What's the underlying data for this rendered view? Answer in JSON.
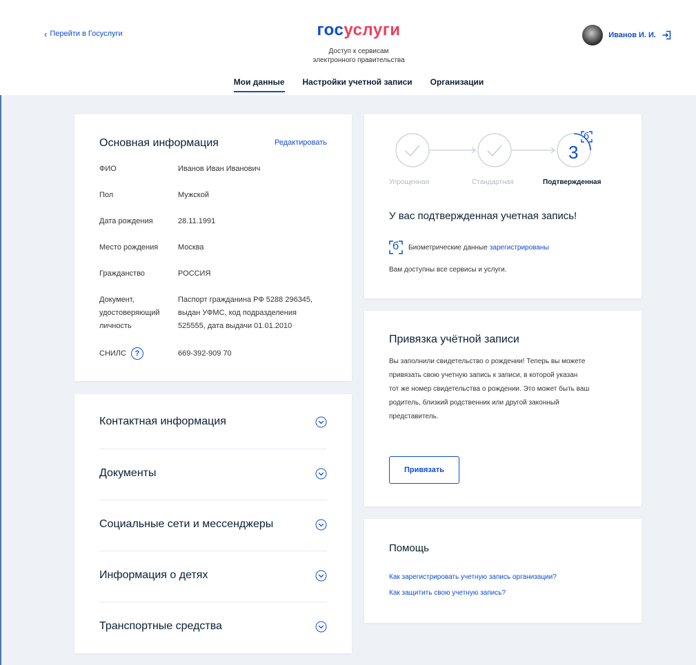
{
  "header": {
    "back_label": "Перейти в Госуслуги",
    "logo_part1": "гос",
    "logo_part2": "услуги",
    "subtitle_line1": "Доступ к сервисам",
    "subtitle_line2": "электронного правительства",
    "user_name": "Иванов И. И.",
    "tabs": [
      {
        "label": "Мои данные",
        "active": true
      },
      {
        "label": "Настройки учетной записи",
        "active": false
      },
      {
        "label": "Организации",
        "active": false
      }
    ]
  },
  "basic_info": {
    "title": "Основная информация",
    "edit_label": "Редактировать",
    "rows": [
      {
        "label": "ФИО",
        "value": "Иванов Иван Иванович"
      },
      {
        "label": "Пол",
        "value": "Мужской"
      },
      {
        "label": "Дата рождения",
        "value": "28.11.1991"
      },
      {
        "label": "Место рождения",
        "value": "Москва"
      },
      {
        "label": "Гражданство",
        "value": "РОССИЯ"
      },
      {
        "label_lines": [
          "Документ,",
          "удостоверяющий",
          "личность"
        ],
        "value_lines": [
          "Паспорт гражданина РФ 5288 296345,",
          "выдан УФМС, код подразделения",
          "525555, дата выдачи 01.01.2010"
        ]
      },
      {
        "label": "СНИЛС",
        "value": "669-392-909 70",
        "help": "?"
      }
    ]
  },
  "accordion": [
    "Контактная информация",
    "Документы",
    "Социальные сети и мессенджеры",
    "Информация о детях",
    "Транспортные средства"
  ],
  "status": {
    "steps": [
      "Упрощенная",
      "Стандартная",
      "Подтвержденная"
    ],
    "current_level": "3",
    "badge_letter": "б",
    "title": "У вас подтвержденная учетная запись!",
    "bio_text": "Биометрические данные",
    "bio_link": "зарегистрированы",
    "available": "Вам доступны все сервисы и услуги."
  },
  "binding": {
    "title": "Привязка учётной записи",
    "text_lines": [
      "Вы заполнили свидетельство о рождении! Теперь вы можете",
      "привязать свою учетную запись к записи, в которой указан",
      "тот же номер свидетельства о рождении. Это может быть ваш",
      "родитель, близкий родственник или другой законный",
      "представитель."
    ],
    "button_label": "Привязать"
  },
  "help": {
    "title": "Помощь",
    "links": [
      "Как зарегистрировать учетную запись организации?",
      "Как защитить свою учетную запись?"
    ]
  },
  "colors": {
    "brand_blue": "#0d4cd3",
    "brand_red": "#ee3f58",
    "background": "#eef2f7"
  }
}
